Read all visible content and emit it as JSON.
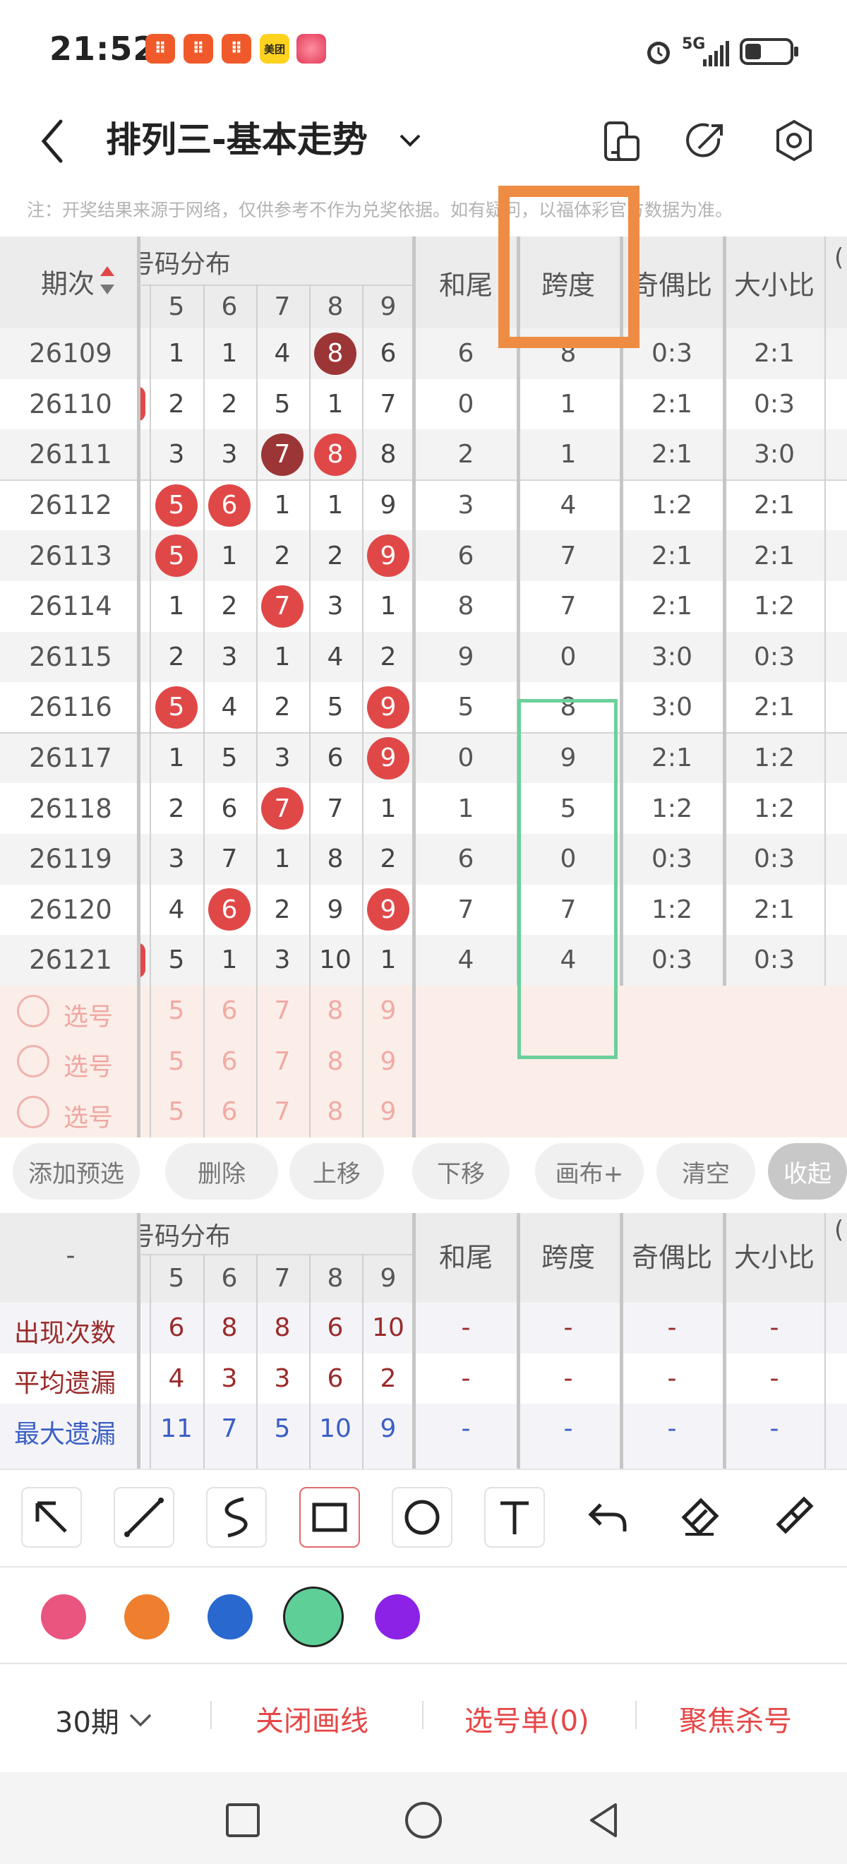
{
  "status": {
    "time": "21:52",
    "meituan_label": "美团",
    "network": "5G",
    "app_icon_char": "88"
  },
  "header": {
    "title": "排列三-基本走势"
  },
  "note": "注：开奖结果来源于网络，仅供参考不作为兑奖依据。如有疑问，以福体彩官方数据为准。",
  "table": {
    "period_header": "期次",
    "group_header": "号码分布",
    "digit_headers": [
      "5",
      "6",
      "7",
      "8",
      "9"
    ],
    "col_headers": [
      "和尾",
      "跨度",
      "奇偶比",
      "大小比"
    ],
    "rows": [
      {
        "period": "26109",
        "cells": [
          "1",
          "1",
          "4",
          "8",
          "6"
        ],
        "hits": [
          3
        ],
        "style": "dark",
        "hewei": "6",
        "kuadu": "8",
        "jiou": "0:3",
        "daxiao": "2:1"
      },
      {
        "period": "26110",
        "cells": [
          "2",
          "2",
          "5",
          "1",
          "7"
        ],
        "hits": [],
        "style": "red",
        "hewei": "0",
        "kuadu": "1",
        "jiou": "2:1",
        "daxiao": "0:3",
        "left_ball": true
      },
      {
        "period": "26111",
        "cells": [
          "3",
          "3",
          "7",
          "8",
          "8"
        ],
        "hits": [
          2,
          3
        ],
        "style": "mixed",
        "hewei": "2",
        "kuadu": "1",
        "jiou": "2:1",
        "daxiao": "3:0"
      },
      {
        "period": "26112",
        "cells": [
          "5",
          "6",
          "1",
          "1",
          "9"
        ],
        "hits": [
          0,
          1
        ],
        "style": "red",
        "hewei": "3",
        "kuadu": "4",
        "jiou": "1:2",
        "daxiao": "2:1"
      },
      {
        "period": "26113",
        "cells": [
          "5",
          "1",
          "2",
          "2",
          "9"
        ],
        "hits": [
          0,
          4
        ],
        "style": "red",
        "hewei": "6",
        "kuadu": "7",
        "jiou": "2:1",
        "daxiao": "2:1"
      },
      {
        "period": "26114",
        "cells": [
          "1",
          "2",
          "7",
          "3",
          "1"
        ],
        "hits": [
          2
        ],
        "style": "red",
        "hewei": "8",
        "kuadu": "7",
        "jiou": "2:1",
        "daxiao": "1:2"
      },
      {
        "period": "26115",
        "cells": [
          "2",
          "3",
          "1",
          "4",
          "2"
        ],
        "hits": [],
        "style": "red",
        "hewei": "9",
        "kuadu": "0",
        "jiou": "3:0",
        "daxiao": "0:3"
      },
      {
        "period": "26116",
        "cells": [
          "5",
          "4",
          "2",
          "5",
          "9"
        ],
        "hits": [
          0,
          4
        ],
        "style": "red",
        "hewei": "5",
        "kuadu": "8",
        "jiou": "3:0",
        "daxiao": "2:1"
      },
      {
        "period": "26117",
        "cells": [
          "1",
          "5",
          "3",
          "6",
          "9"
        ],
        "hits": [
          4
        ],
        "style": "red",
        "hewei": "0",
        "kuadu": "9",
        "jiou": "2:1",
        "daxiao": "1:2"
      },
      {
        "period": "26118",
        "cells": [
          "2",
          "6",
          "7",
          "7",
          "1"
        ],
        "hits": [
          2
        ],
        "style": "red",
        "hewei": "1",
        "kuadu": "5",
        "jiou": "1:2",
        "daxiao": "1:2"
      },
      {
        "period": "26119",
        "cells": [
          "3",
          "7",
          "1",
          "8",
          "2"
        ],
        "hits": [],
        "style": "red",
        "hewei": "6",
        "kuadu": "0",
        "jiou": "0:3",
        "daxiao": "0:3"
      },
      {
        "period": "26120",
        "cells": [
          "4",
          "6",
          "2",
          "9",
          "9"
        ],
        "hits": [
          1,
          4
        ],
        "style": "red",
        "hewei": "7",
        "kuadu": "7",
        "jiou": "1:2",
        "daxiao": "2:1"
      },
      {
        "period": "26121",
        "cells": [
          "5",
          "1",
          "3",
          "10",
          "1"
        ],
        "hits": [],
        "style": "red",
        "hewei": "4",
        "kuadu": "4",
        "jiou": "0:3",
        "daxiao": "0:3",
        "left_ball": true
      }
    ],
    "select_rows": [
      {
        "label": "选号",
        "digits": [
          "5",
          "6",
          "7",
          "8",
          "9"
        ]
      },
      {
        "label": "选号",
        "digits": [
          "5",
          "6",
          "7",
          "8",
          "9"
        ]
      },
      {
        "label": "选号",
        "digits": [
          "5",
          "6",
          "7",
          "8",
          "9"
        ]
      }
    ]
  },
  "actions": [
    "添加预选",
    "删除",
    "上移",
    "下移",
    "画布+",
    "清空",
    "收起"
  ],
  "stats": {
    "corner": "-",
    "group_header": "号码分布",
    "digit_headers": [
      "5",
      "6",
      "7",
      "8",
      "9"
    ],
    "col_headers": [
      "和尾",
      "跨度",
      "奇偶比",
      "大小比"
    ],
    "rows": [
      {
        "label": "出现次数",
        "vals": [
          "6",
          "8",
          "8",
          "6",
          "10"
        ],
        "rest": [
          "-",
          "-",
          "-",
          "-"
        ],
        "color": "#9a2b2b"
      },
      {
        "label": "平均遗漏",
        "vals": [
          "4",
          "3",
          "3",
          "6",
          "2"
        ],
        "rest": [
          "-",
          "-",
          "-",
          "-"
        ],
        "color": "#9a2b2b"
      },
      {
        "label": "最大遗漏",
        "vals": [
          "11",
          "7",
          "5",
          "10",
          "9"
        ],
        "rest": [
          "-",
          "-",
          "-",
          "-"
        ],
        "color": "#3b5fc4"
      }
    ]
  },
  "colors": [
    "#e9557f",
    "#ef7f2e",
    "#2868cf",
    "#5ecf97",
    "#8b22e6"
  ],
  "tools": [
    "arrow-tool",
    "line-tool",
    "freehand-tool",
    "rect-tool",
    "circle-tool",
    "text-tool",
    "undo-tool",
    "eraser-tool",
    "clear-brush-tool"
  ],
  "bottom": {
    "periods": "30期",
    "close_draw": "关闭画线",
    "pick_list": "选号单(0)",
    "focus_kill": "聚焦杀号"
  }
}
